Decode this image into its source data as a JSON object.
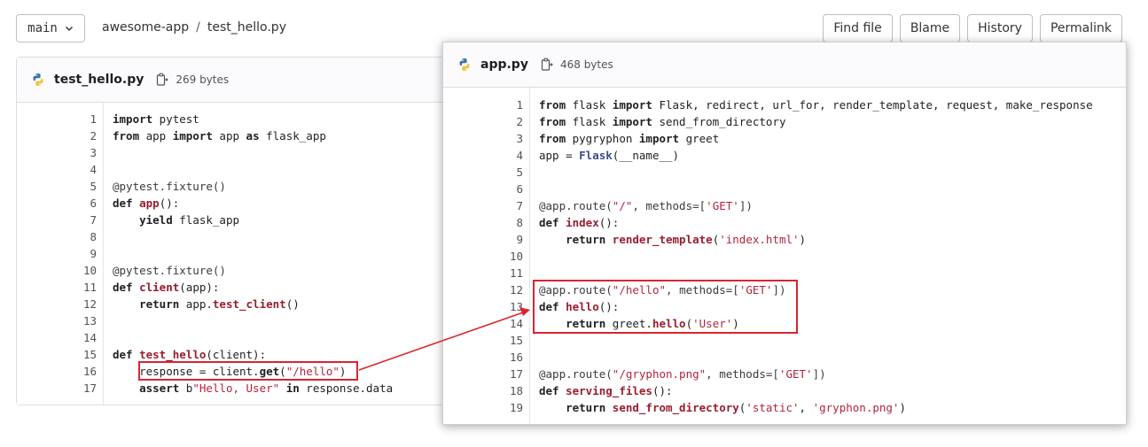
{
  "branch": {
    "label": "main"
  },
  "breadcrumb": {
    "repo": "awesome-app",
    "separator": "/",
    "file": "test_hello.py"
  },
  "actions": [
    {
      "label": "Find file"
    },
    {
      "label": "Blame"
    },
    {
      "label": "History"
    },
    {
      "label": "Permalink"
    }
  ],
  "left_file": {
    "name": "test_hello.py",
    "size": "269 bytes",
    "lines": [
      {
        "n": "1",
        "tokens": [
          [
            "kw",
            "import"
          ],
          [
            "t",
            " pytest"
          ]
        ]
      },
      {
        "n": "2",
        "tokens": [
          [
            "kw",
            "from"
          ],
          [
            "t",
            " app "
          ],
          [
            "kw",
            "import"
          ],
          [
            "t",
            " app "
          ],
          [
            "kw",
            "as"
          ],
          [
            "t",
            " flask_app"
          ]
        ]
      },
      {
        "n": "3",
        "tokens": []
      },
      {
        "n": "4",
        "tokens": []
      },
      {
        "n": "5",
        "tokens": [
          [
            "dec",
            "@pytest.fixture()"
          ]
        ]
      },
      {
        "n": "6",
        "tokens": [
          [
            "kw",
            "def"
          ],
          [
            "t",
            " "
          ],
          [
            "fn",
            "app"
          ],
          [
            "t",
            "():"
          ]
        ]
      },
      {
        "n": "7",
        "tokens": [
          [
            "t",
            "    "
          ],
          [
            "kw",
            "yield"
          ],
          [
            "t",
            " flask_app"
          ]
        ]
      },
      {
        "n": "8",
        "tokens": []
      },
      {
        "n": "9",
        "tokens": []
      },
      {
        "n": "10",
        "tokens": [
          [
            "dec",
            "@pytest.fixture()"
          ]
        ]
      },
      {
        "n": "11",
        "tokens": [
          [
            "kw",
            "def"
          ],
          [
            "t",
            " "
          ],
          [
            "fn",
            "client"
          ],
          [
            "t",
            "(app):"
          ]
        ]
      },
      {
        "n": "12",
        "tokens": [
          [
            "t",
            "    "
          ],
          [
            "kw",
            "return"
          ],
          [
            "t",
            " app."
          ],
          [
            "fn",
            "test_client"
          ],
          [
            "t",
            "()"
          ]
        ]
      },
      {
        "n": "13",
        "tokens": []
      },
      {
        "n": "14",
        "tokens": []
      },
      {
        "n": "15",
        "tokens": [
          [
            "kw",
            "def"
          ],
          [
            "t",
            " "
          ],
          [
            "fn",
            "test_hello"
          ],
          [
            "t",
            "(client):"
          ]
        ]
      },
      {
        "n": "16",
        "tokens": [
          [
            "t",
            "    response = client."
          ],
          [
            "kw",
            "get"
          ],
          [
            "t",
            "("
          ],
          [
            "str",
            "\"/hello\""
          ],
          [
            "t",
            ")"
          ]
        ]
      },
      {
        "n": "17",
        "tokens": [
          [
            "t",
            "    "
          ],
          [
            "kw",
            "assert"
          ],
          [
            "t",
            " b"
          ],
          [
            "str",
            "\"Hello, User\""
          ],
          [
            "t",
            " "
          ],
          [
            "kw",
            "in"
          ],
          [
            "t",
            " response.data"
          ]
        ]
      }
    ]
  },
  "right_file": {
    "name": "app.py",
    "size": "468 bytes",
    "lines": [
      {
        "n": "1",
        "tokens": [
          [
            "kw",
            "from"
          ],
          [
            "t",
            " flask "
          ],
          [
            "kw",
            "import"
          ],
          [
            "t",
            " Flask, redirect, url_for, render_template, request, make_response"
          ]
        ]
      },
      {
        "n": "2",
        "tokens": [
          [
            "kw",
            "from"
          ],
          [
            "t",
            " flask "
          ],
          [
            "kw",
            "import"
          ],
          [
            "t",
            " send_from_directory"
          ]
        ]
      },
      {
        "n": "3",
        "tokens": [
          [
            "kw",
            "from"
          ],
          [
            "t",
            " pygryphon "
          ],
          [
            "kw",
            "import"
          ],
          [
            "t",
            " greet"
          ]
        ]
      },
      {
        "n": "4",
        "tokens": [
          [
            "t",
            "app = "
          ],
          [
            "cls",
            "Flask"
          ],
          [
            "t",
            "(__name__)"
          ]
        ]
      },
      {
        "n": "5",
        "tokens": []
      },
      {
        "n": "6",
        "tokens": []
      },
      {
        "n": "7",
        "tokens": [
          [
            "dec",
            "@app.route("
          ],
          [
            "str",
            "\"/\""
          ],
          [
            "dec",
            ", methods=["
          ],
          [
            "str",
            "'GET'"
          ],
          [
            "dec",
            "])"
          ]
        ]
      },
      {
        "n": "8",
        "tokens": [
          [
            "kw",
            "def"
          ],
          [
            "t",
            " "
          ],
          [
            "fn",
            "index"
          ],
          [
            "t",
            "():"
          ]
        ]
      },
      {
        "n": "9",
        "tokens": [
          [
            "t",
            "    "
          ],
          [
            "kw",
            "return"
          ],
          [
            "t",
            " "
          ],
          [
            "fn",
            "render_template"
          ],
          [
            "t",
            "("
          ],
          [
            "str",
            "'index.html'"
          ],
          [
            "t",
            ")"
          ]
        ]
      },
      {
        "n": "10",
        "tokens": []
      },
      {
        "n": "11",
        "tokens": []
      },
      {
        "n": "12",
        "tokens": [
          [
            "dec",
            "@app.route("
          ],
          [
            "str",
            "\"/hello\""
          ],
          [
            "dec",
            ", methods=["
          ],
          [
            "str",
            "'GET'"
          ],
          [
            "dec",
            "])"
          ]
        ]
      },
      {
        "n": "13",
        "tokens": [
          [
            "kw",
            "def"
          ],
          [
            "t",
            " "
          ],
          [
            "fn",
            "hello"
          ],
          [
            "t",
            "():"
          ]
        ]
      },
      {
        "n": "14",
        "tokens": [
          [
            "t",
            "    "
          ],
          [
            "kw",
            "return"
          ],
          [
            "t",
            " greet."
          ],
          [
            "fn",
            "hello"
          ],
          [
            "t",
            "("
          ],
          [
            "str",
            "'User'"
          ],
          [
            "t",
            ")"
          ]
        ]
      },
      {
        "n": "15",
        "tokens": []
      },
      {
        "n": "16",
        "tokens": []
      },
      {
        "n": "17",
        "tokens": [
          [
            "dec",
            "@app.route("
          ],
          [
            "str",
            "\"/gryphon.png\""
          ],
          [
            "dec",
            ", methods=["
          ],
          [
            "str",
            "'GET'"
          ],
          [
            "dec",
            "])"
          ]
        ]
      },
      {
        "n": "18",
        "tokens": [
          [
            "kw",
            "def"
          ],
          [
            "t",
            " "
          ],
          [
            "fn",
            "serving_files"
          ],
          [
            "t",
            "():"
          ]
        ]
      },
      {
        "n": "19",
        "tokens": [
          [
            "t",
            "    "
          ],
          [
            "kw",
            "return"
          ],
          [
            "t",
            " "
          ],
          [
            "fn",
            "send_from_directory"
          ],
          [
            "t",
            "("
          ],
          [
            "str",
            "'static'"
          ],
          [
            "t",
            ", "
          ],
          [
            "str",
            "'gryphon.png'"
          ],
          [
            "t",
            ")"
          ]
        ]
      }
    ]
  },
  "colors": {
    "highlight": "#d9252e",
    "keyword": "#1f1e24",
    "function": "#9b1d2e",
    "string": "#b4243c",
    "class": "#3c4d8a"
  },
  "icons": {
    "branch_dropdown": "chevron-down-icon",
    "file_type": "python-icon",
    "copy": "copy-icon"
  }
}
